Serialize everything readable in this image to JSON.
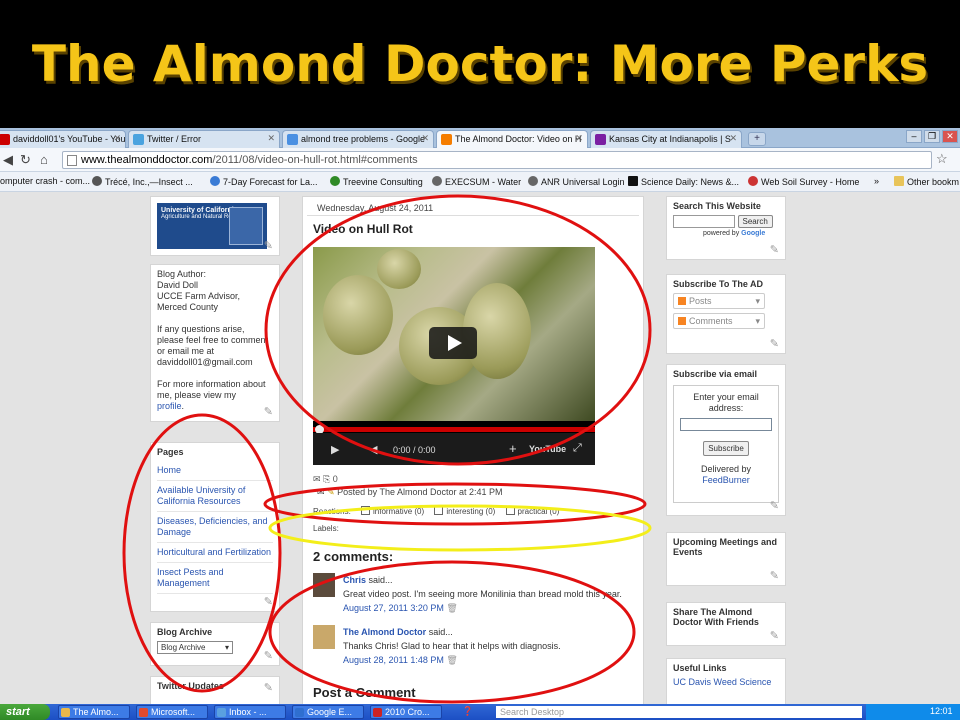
{
  "slide": {
    "title": "The Almond Doctor: More Perks"
  },
  "browser": {
    "tabs": [
      {
        "label": "daviddoll01's YouTube - YouTu",
        "color": "#cc0000"
      },
      {
        "label": "Twitter / Error",
        "color": "#4aa3df"
      },
      {
        "label": "almond tree problems - Google",
        "color": "#4a90e2"
      },
      {
        "label": "The Almond Doctor: Video on H",
        "color": "#f57d00"
      },
      {
        "label": "Kansas City at Indianapolis | S",
        "color": "#7b1fa2"
      }
    ],
    "new_tab_label": "+",
    "url_domain": "www.thealmonddoctor.com",
    "url_rest": "/2011/08/video-on-hull-rot.html#comments",
    "bookmarks": [
      "omputer crash - com...",
      "Trécé, Inc.,—Insect ...",
      "7-Day Forecast for La...",
      "Treevine Consulting",
      "EXECSUM - Water",
      "ANR Universal Login",
      "Science Daily: News &...",
      "Web Soil Survey - Home"
    ],
    "more_bookmarks": "»",
    "other_bookmarks": "Other bookm"
  },
  "left": {
    "author_label": "Blog Author:",
    "author_name": "David Doll",
    "author_title": "UCCE Farm Advisor,",
    "author_county": "Merced County",
    "questions_text": "If any questions arise, please feel free to comment or email me at",
    "email": "daviddoll01@gmail.com",
    "info_text": "For more information about me, please view my",
    "profile_link": "profile",
    "profile_suffix": ".",
    "pages_title": "Pages",
    "pages": [
      "Home",
      "Available University of California Resources",
      "Diseases, Deficiencies, and Damage",
      "Horticultural and Fertilization",
      "Insect Pests and Management"
    ],
    "archive_title": "Blog Archive",
    "archive_select": "Blog Archive",
    "twitter_title": "Twitter Updates"
  },
  "post": {
    "date": "Wednesday, August 24, 2011",
    "title": "Video on Hull Rot",
    "video_time": "0:00 / 0:00",
    "share_count": "0",
    "posted_by": "Posted by The Almond Doctor at 2:41 PM",
    "reactions_label": "Reactions:",
    "reactions": [
      "informative (0)",
      "interesting (0)",
      "practical (0)"
    ],
    "labels_label": "Labels:",
    "comments_heading": "2 comments:",
    "comments": [
      {
        "author": "Chris",
        "said": "said...",
        "text": "Great video post. I'm seeing more Monilinia than bread mold this year.",
        "date": "August 27, 2011 3:20 PM"
      },
      {
        "author": "The Almond Doctor",
        "said": "said...",
        "text": "Thanks Chris! Glad to hear that it helps with diagnosis.",
        "date": "August 28, 2011 1:48 PM"
      }
    ],
    "post_a_comment": "Post a Comment"
  },
  "right": {
    "search_title": "Search This Website",
    "search_button": "Search",
    "powered_by": "powered by",
    "google": "Google",
    "subscribe_title": "Subscribe To The AD",
    "feed_posts": "Posts",
    "feed_comments": "Comments",
    "email_title": "Subscribe via email",
    "email_prompt": "Enter your email address:",
    "subscribe_button": "Subscribe",
    "delivered_by": "Delivered by",
    "feedburner": "FeedBurner",
    "meetings_title": "Upcoming Meetings and Events",
    "share_title": "Share The Almond Doctor With Friends",
    "useful_title": "Useful Links",
    "useful_first": "UC Davis Weed Science"
  },
  "taskbar": {
    "start": "start",
    "tasks": [
      "The Almo...",
      "Microsoft...",
      "Inbox - ...",
      "Google E...",
      "2010 Cro..."
    ],
    "search_placeholder": "Search Desktop",
    "clock": "12:01"
  },
  "colors": {
    "title_gold": "#f5c518",
    "annotation_red": "#e01010",
    "annotation_yellow": "#f3ee1a"
  }
}
